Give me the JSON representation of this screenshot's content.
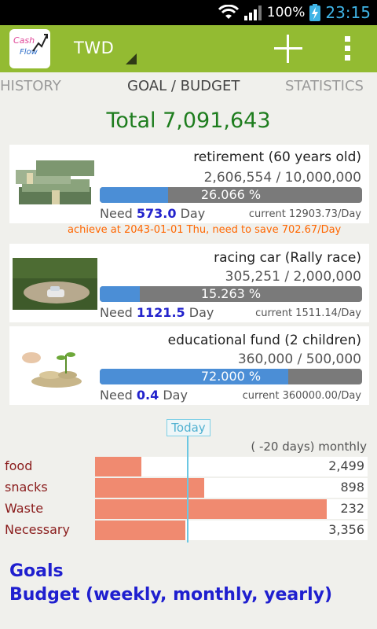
{
  "status": {
    "battery": "100%",
    "time": "23:15"
  },
  "header": {
    "logo_top": "Cash",
    "logo_bottom": "Flow",
    "currency": "TWD"
  },
  "tabs": [
    "HISTORY",
    "GOAL / BUDGET",
    "STATISTICS"
  ],
  "total": "Total 7,091,643",
  "goals": [
    {
      "name": "retirement (60 years old)",
      "amount": "2,606,554 / 10,000,000",
      "percent": "26.066 %",
      "progress": 0.26066,
      "need_label": "Need",
      "need_value": "573.0",
      "need_unit": "Day",
      "current": "current 12903.73/Day"
    },
    {
      "name": "racing car (Rally race)",
      "amount": "305,251 / 2,000,000",
      "percent": "15.263 %",
      "progress": 0.15263,
      "need_label": "Need",
      "need_value": "1121.5",
      "need_unit": "Day",
      "current": "current 1511.14/Day"
    },
    {
      "name": "educational fund (2 children)",
      "amount": "360,000 / 500,000",
      "percent": "72.000 %",
      "progress": 0.72,
      "need_label": "Need",
      "need_value": "0.4",
      "need_unit": "Day",
      "current": "current 360000.00/Day"
    }
  ],
  "achieve_note": "achieve at 2043-01-01 Thu, need to save  702.67/Day",
  "budget": {
    "today_label": "Today",
    "period": "( -20 days) monthly",
    "items": [
      {
        "label": "food",
        "value": "2,499",
        "fill": 0.17
      },
      {
        "label": "snacks",
        "value": "898",
        "fill": 0.4
      },
      {
        "label": "Waste",
        "value": "232",
        "fill": 0.85
      },
      {
        "label": "Necessary",
        "value": "3,356",
        "fill": 0.33
      }
    ]
  },
  "promo": {
    "line1": "Goals",
    "line2": "Budget (weekly, monthly, yearly)"
  },
  "colors": {
    "accent": "#93bb32",
    "progress": "#4b8ed6",
    "budget_fill": "#f08a70",
    "total": "#1e7d1e"
  }
}
